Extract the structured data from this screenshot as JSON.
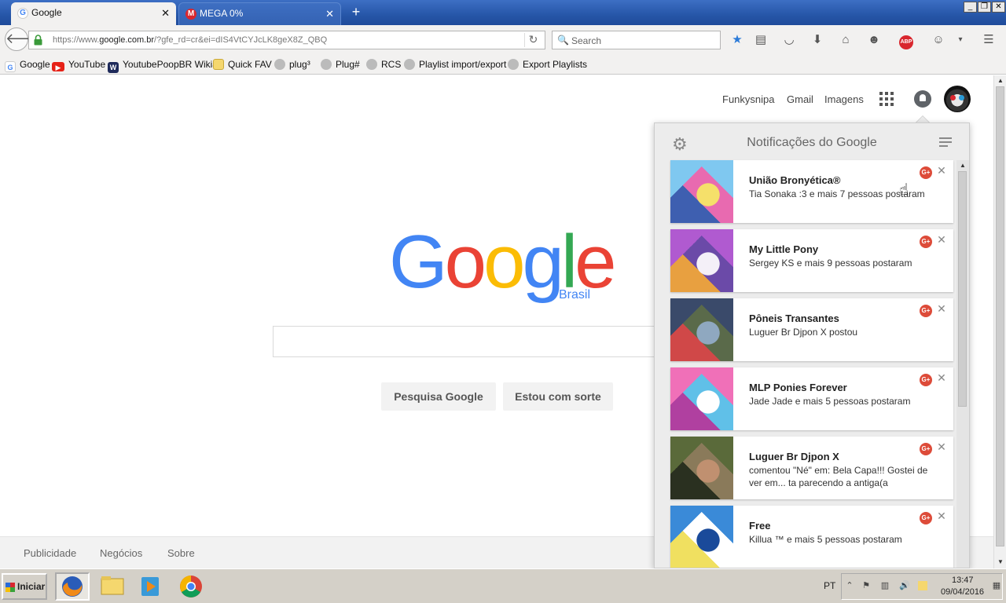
{
  "browser": {
    "tabs": [
      {
        "label": "Google",
        "favicon": "G"
      },
      {
        "label": "MEGA 0%",
        "favicon": "M"
      }
    ],
    "new_tab_label": "+",
    "url": {
      "prefix": "https://www.",
      "domain": "google.com.br",
      "rest": "/?gfe_rd=cr&ei=dIS4VtCYJcLK8geX8Z_QBQ"
    },
    "search_placeholder": "Search",
    "bookmarks": [
      {
        "label": "Google",
        "icon": "google-icon"
      },
      {
        "label": "YouTube",
        "icon": "youtube-icon"
      },
      {
        "label": "YoutubePoopBR Wikia",
        "icon": "wikia-icon"
      },
      {
        "label": "Quick FAV",
        "icon": "folder-icon"
      },
      {
        "label": "plug³",
        "icon": "globe-icon"
      },
      {
        "label": "Plug#",
        "icon": "globe-icon"
      },
      {
        "label": "RCS",
        "icon": "globe-icon"
      },
      {
        "label": "Playlist import/export",
        "icon": "globe-icon"
      },
      {
        "label": "Export Playlists",
        "icon": "globe-icon"
      }
    ],
    "abp_label": "ABP"
  },
  "google": {
    "top_links": {
      "user": "Funkysnipa",
      "gmail": "Gmail",
      "images": "Imagens"
    },
    "logo_letters": [
      "G",
      "o",
      "o",
      "g",
      "l",
      "e"
    ],
    "logo_colors": [
      "#4285F4",
      "#EA4335",
      "#FBBC05",
      "#4285F4",
      "#34A853",
      "#EA4335"
    ],
    "logo_sub": "Brasil",
    "buttons": {
      "search": "Pesquisa Google",
      "lucky": "Estou com sorte"
    },
    "footer": [
      "Publicidade",
      "Negócios",
      "Sobre"
    ]
  },
  "notifications": {
    "title": "Notificações do Google",
    "items": [
      {
        "title": "União Bronyética®",
        "text": "Tia Sonaka :3 e mais 7 pessoas postaram",
        "thumb_colors": [
          "#7fc8f0",
          "#f5e06a",
          "#3e5fb0",
          "#e86ab0"
        ]
      },
      {
        "title": "My Little Pony",
        "text": "Sergey KS e mais 9 pessoas postaram",
        "thumb_colors": [
          "#b05ad0",
          "#f4f0f8",
          "#e8a040",
          "#6b4aa8"
        ]
      },
      {
        "title": "Pôneis Transantes",
        "text": "Luguer Br Djpon X postou",
        "thumb_colors": [
          "#3a4a6a",
          "#8fa8c0",
          "#d04848",
          "#5a6a4a"
        ]
      },
      {
        "title": "MLP Ponies Forever",
        "text": "Jade Jade e mais 5 pessoas postaram",
        "thumb_colors": [
          "#f070b8",
          "#ffffff",
          "#b040a0",
          "#60c0e8"
        ]
      },
      {
        "title": "Luguer Br Djpon X",
        "text": "comentou \"Né\" em: Bela Capa!!! Gostei de ver em... ta parecendo a antiga(a",
        "thumb_colors": [
          "#5a6a3a",
          "#c09070",
          "#2a3020",
          "#8a7a5a"
        ]
      },
      {
        "title": "Free",
        "text": "Killua ™ e mais 5 pessoas postaram",
        "thumb_colors": [
          "#3a8ad8",
          "#1a4a9a",
          "#f0e060",
          "#ffffff"
        ]
      }
    ]
  },
  "taskbar": {
    "start_label": "Iniciar",
    "lang": "PT",
    "time": "13:47",
    "date": "09/04/2016"
  }
}
